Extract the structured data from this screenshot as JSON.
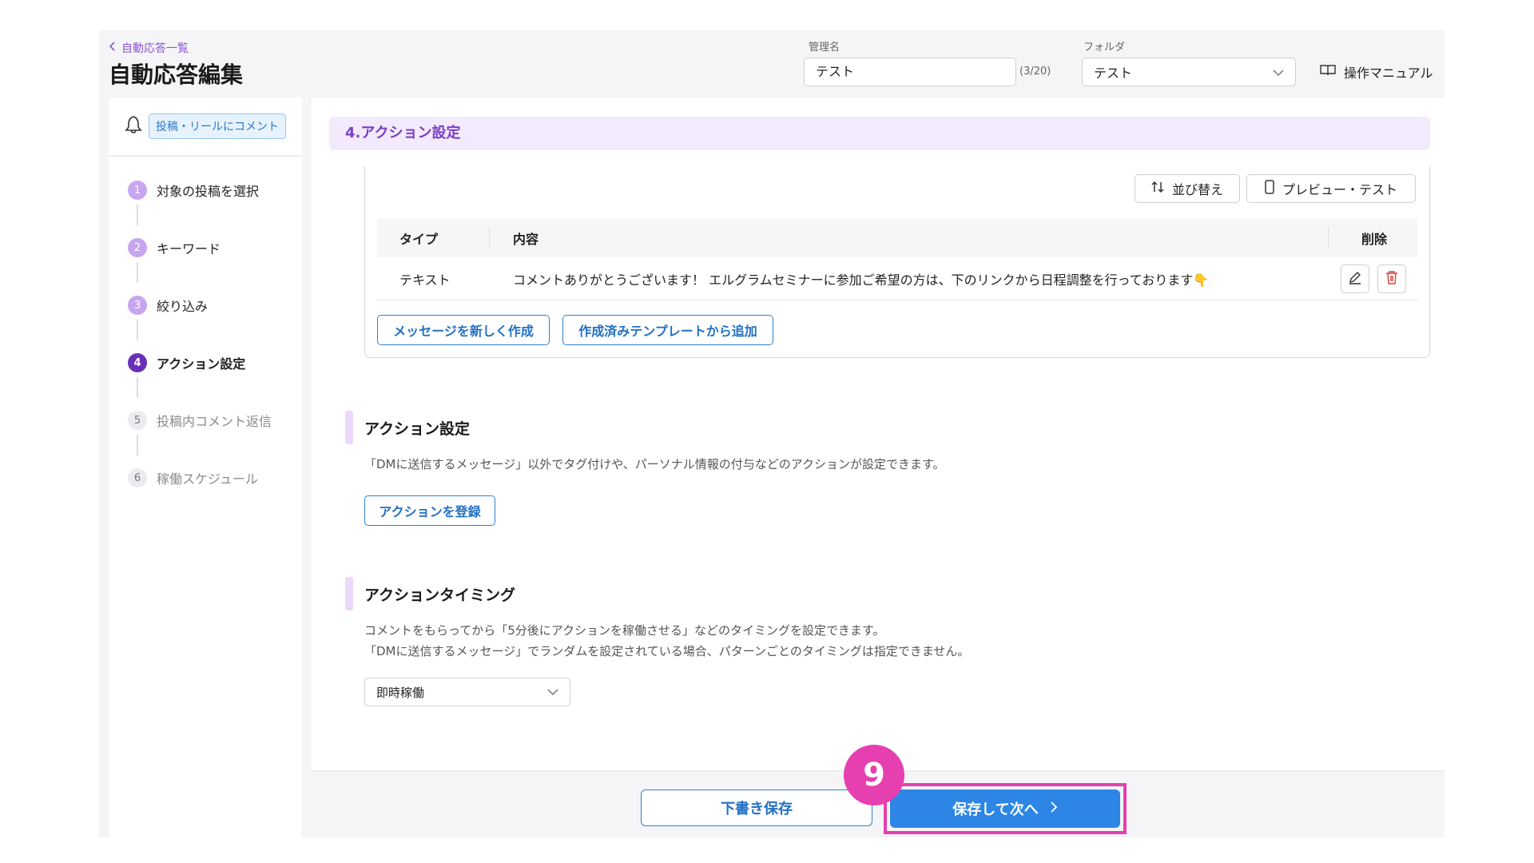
{
  "header": {
    "back_link": "自動応答一覧",
    "title": "自動応答編集",
    "admin_name_label": "管理名",
    "admin_name_value": "テスト",
    "admin_name_counter": "(3/20)",
    "folder_label": "フォルダ",
    "folder_value": "テスト",
    "manual_label": "操作マニュアル"
  },
  "sidebar": {
    "trigger_badge": "投稿・リールにコメント",
    "steps": [
      {
        "num": "1",
        "label": "対象の投稿を選択"
      },
      {
        "num": "2",
        "label": "キーワード"
      },
      {
        "num": "3",
        "label": "絞り込み"
      },
      {
        "num": "4",
        "label": "アクション設定"
      },
      {
        "num": "5",
        "label": "投稿内コメント返信"
      },
      {
        "num": "6",
        "label": "稼働スケジュール"
      }
    ]
  },
  "main": {
    "section_title": "4.アクション設定",
    "sort_button": "並び替え",
    "preview_button": "プレビュー・テスト",
    "table": {
      "headers": {
        "type": "タイプ",
        "content": "内容",
        "delete": "削除"
      },
      "rows": [
        {
          "type": "テキスト",
          "content": "コメントありがとうございます！ エルグラムセミナーに参加ご希望の方は、下のリンクから日程調整を行っております👇"
        }
      ]
    },
    "new_message_button": "メッセージを新しく作成",
    "template_button": "作成済みテンプレートから追加",
    "action_settings": {
      "title": "アクション設定",
      "description": "「DMに送信するメッセージ」以外でタグ付けや、パーソナル情報の付与などのアクションが設定できます。",
      "register_button": "アクションを登録"
    },
    "action_timing": {
      "title": "アクションタイミング",
      "description_1": "コメントをもらってから「5分後にアクションを稼働させる」などのタイミングを設定できます。",
      "description_2": "「DMに送信するメッセージ」でランダムを設定されている場合、パターンごとのタイミングは指定できません。",
      "select_value": "即時稼働"
    }
  },
  "footer": {
    "draft_button": "下書き保存",
    "save_next_button": "保存して次へ",
    "step_marker": "9"
  },
  "colors": {
    "accent_purple": "#7a3fc7",
    "active_step": "#6a2fb8",
    "primary_blue": "#2d86e5",
    "highlight_pink": "#e63fb0"
  }
}
